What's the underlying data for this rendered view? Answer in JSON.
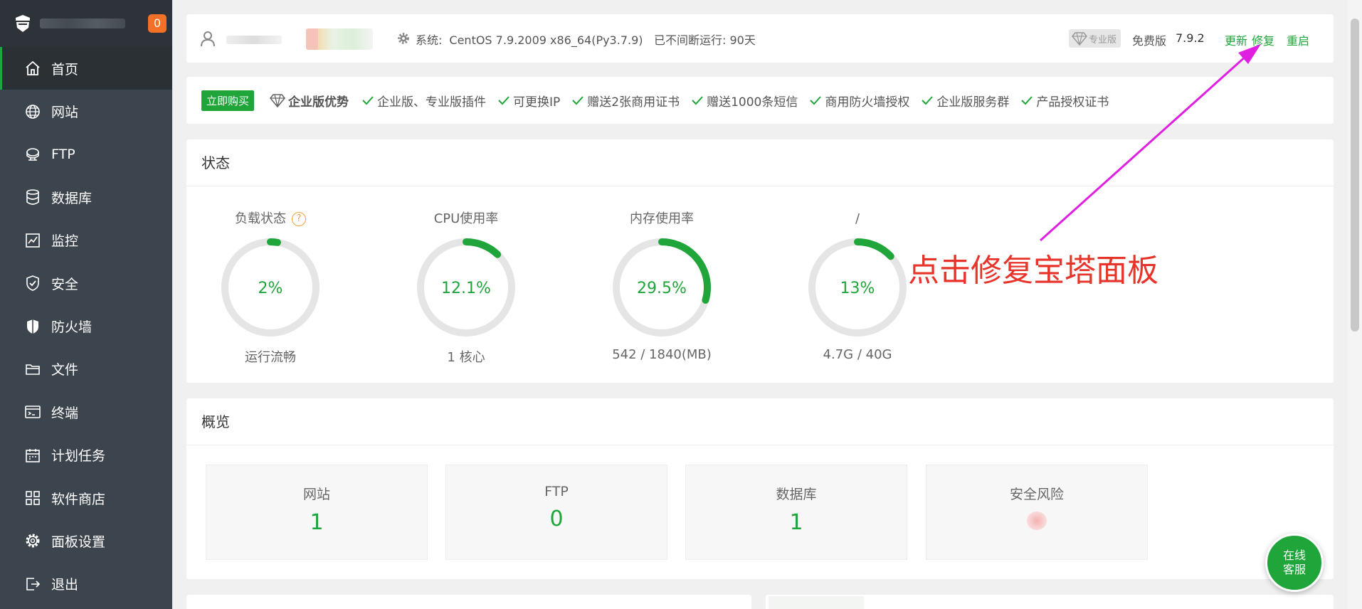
{
  "sidebar": {
    "badge": "0",
    "items": [
      {
        "label": "首页",
        "icon": "home-icon"
      },
      {
        "label": "网站",
        "icon": "globe-icon"
      },
      {
        "label": "FTP",
        "icon": "ftp-icon"
      },
      {
        "label": "数据库",
        "icon": "database-icon"
      },
      {
        "label": "监控",
        "icon": "monitor-icon"
      },
      {
        "label": "安全",
        "icon": "shield-check-icon"
      },
      {
        "label": "防火墙",
        "icon": "firewall-icon"
      },
      {
        "label": "文件",
        "icon": "folder-icon"
      },
      {
        "label": "终端",
        "icon": "terminal-icon"
      },
      {
        "label": "计划任务",
        "icon": "calendar-icon"
      },
      {
        "label": "软件商店",
        "icon": "apps-icon"
      },
      {
        "label": "面板设置",
        "icon": "settings-icon"
      },
      {
        "label": "退出",
        "icon": "logout-icon"
      }
    ]
  },
  "header": {
    "system_label": "系统:",
    "system_value": "CentOS 7.9.2009 x86_64(Py3.7.9)",
    "uptime": "已不间断运行: 90天",
    "pro_badge": "专业版",
    "free_label": "免费版",
    "version": "7.9.2",
    "update": "更新",
    "repair": "修复",
    "restart": "重启"
  },
  "promo": {
    "buy": "立即购买",
    "title": "企业版优势",
    "features": [
      "企业版、专业版插件",
      "可更换IP",
      "赠送2张商用证书",
      "赠送1000条短信",
      "商用防火墙授权",
      "企业版服务群",
      "产品授权证书"
    ]
  },
  "status": {
    "title": "状态",
    "gauges": [
      {
        "label": "负载状态",
        "pct": 2,
        "value": "2%",
        "sub": "运行流畅",
        "help": "?"
      },
      {
        "label": "CPU使用率",
        "pct": 12.1,
        "value": "12.1%",
        "sub": "1 核心"
      },
      {
        "label": "内存使用率",
        "pct": 29.5,
        "value": "29.5%",
        "sub": "542 / 1840(MB)"
      },
      {
        "label": "/",
        "pct": 13,
        "value": "13%",
        "sub": "4.7G / 40G"
      }
    ]
  },
  "overview": {
    "title": "概览",
    "boxes": [
      {
        "label": "网站",
        "value": "1"
      },
      {
        "label": "FTP",
        "value": "0"
      },
      {
        "label": "数据库",
        "value": "1"
      },
      {
        "label": "安全风险",
        "value": ""
      }
    ]
  },
  "annotation": {
    "text": "点击修复宝塔面板"
  },
  "chat": {
    "label": "在线\n客服"
  },
  "colors": {
    "accent": "#20a53a",
    "sidebar": "#3c444d",
    "sidebar_head": "#2d3339",
    "badge": "#f27028",
    "annotation": "#e8332a",
    "arrow": "#e020e0",
    "help": "#f0a23c"
  }
}
